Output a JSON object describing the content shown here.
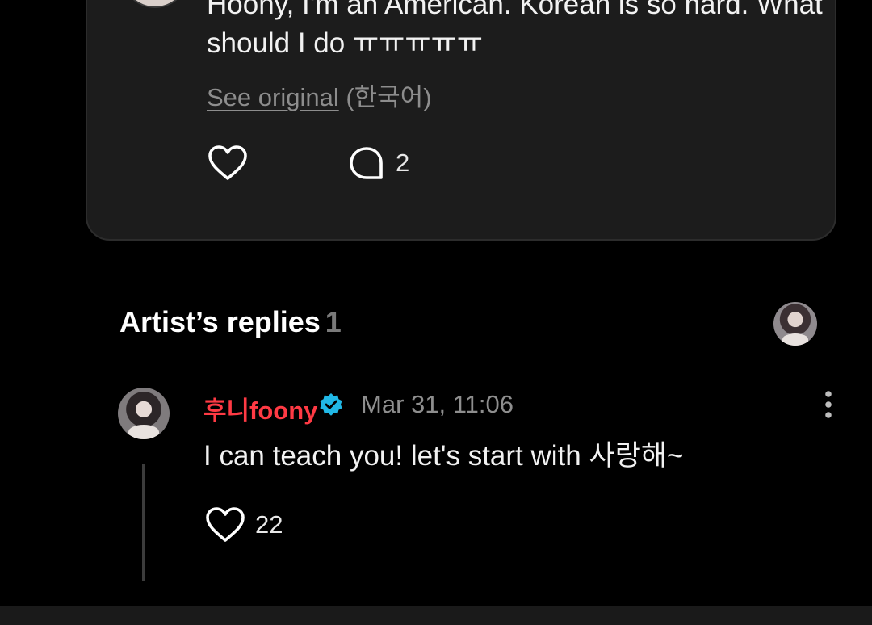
{
  "post": {
    "body": "Hoony, I'm an American. Korean is so hard. What should I do ㅠㅠㅠㅠㅠ",
    "see_original_link": "See original",
    "see_original_language": "(한국어)",
    "comment_count": "2",
    "icons": {
      "like": "heart-outline-icon",
      "comment": "speech-bubble-icon"
    }
  },
  "artist_replies": {
    "title": "Artist’s replies",
    "count": "1",
    "reply": {
      "author": "후니foony",
      "timestamp": "Mar 31, 11:06",
      "text": "I can teach you! let's start with 사랑해~",
      "like_count": "22",
      "icons": {
        "verified": "verified-badge-icon",
        "more": "more-vertical-icon",
        "like": "heart-outline-icon"
      }
    }
  },
  "colors": {
    "background": "#000000",
    "card": "#1c1c1c",
    "author_accent": "#ff3a44",
    "verified": "#21b8e6",
    "muted_text": "#8e8e8e"
  }
}
